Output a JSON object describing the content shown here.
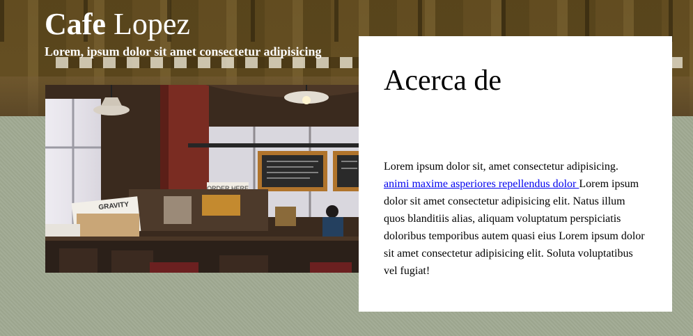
{
  "header": {
    "title_bold": "Cafe",
    "title_rest": " Lopez",
    "subtitle": "Lorem, ipsum dolor sit amet consectetur adipisicing"
  },
  "hero_image": {
    "menu_sign": "ORDER HERE",
    "crate_label": "GRAVITY"
  },
  "about": {
    "heading": "Acerca de",
    "text_before_link": "Lorem ipsum dolor sit, amet consectetur adipisicing. ",
    "link_text": "animi maxime asperiores repellendus dolor ",
    "text_after_link": "Lorem ipsum dolor sit amet consectetur adipisicing elit. Natus illum quos blanditiis alias, aliquam voluptatum perspiciatis doloribus temporibus autem quasi eius Lorem ipsum dolor sit amet consectetur adipisicing elit. Soluta voluptatibus vel fugiat!"
  },
  "colors": {
    "page_background": "#a1aa93",
    "hero_tint": "#6c5326",
    "card_background": "#ffffff",
    "link": "#0000ee"
  }
}
